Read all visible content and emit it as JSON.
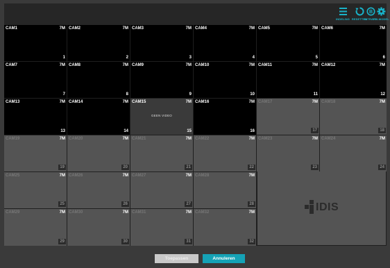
{
  "toolbar": {
    "accent": "#19b3c9",
    "buttons": [
      {
        "name": "layout-button",
        "icon": "layout-list-icon",
        "label": "INDELING"
      },
      {
        "name": "reset-button",
        "icon": "refresh-icon",
        "label": "RESETTEN"
      },
      {
        "name": "bitrate-button",
        "icon": "gauge-icon",
        "label": "BITRATE"
      },
      {
        "name": "full-model-button",
        "icon": "gear-icon",
        "label": "VOLMODEL"
      }
    ]
  },
  "grid": {
    "colors": {
      "active": "#000000",
      "inactive": "#545454"
    },
    "cameras": [
      {
        "name": "CAM1",
        "res": "7M",
        "num": "1",
        "state": "on"
      },
      {
        "name": "CAM2",
        "res": "7M",
        "num": "2",
        "state": "on"
      },
      {
        "name": "CAM3",
        "res": "7M",
        "num": "3",
        "state": "on"
      },
      {
        "name": "CAM4",
        "res": "7M",
        "num": "4",
        "state": "on"
      },
      {
        "name": "CAM5",
        "res": "7M",
        "num": "5",
        "state": "on"
      },
      {
        "name": "CAM6",
        "res": "7M",
        "num": "6",
        "state": "on"
      },
      {
        "name": "CAM7",
        "res": "7M",
        "num": "7",
        "state": "on"
      },
      {
        "name": "CAM8",
        "res": "7M",
        "num": "8",
        "state": "on"
      },
      {
        "name": "CAM9",
        "res": "7M",
        "num": "9",
        "state": "on"
      },
      {
        "name": "CAM10",
        "res": "7M",
        "num": "10",
        "state": "on"
      },
      {
        "name": "CAM11",
        "res": "7M",
        "num": "11",
        "state": "on"
      },
      {
        "name": "CAM12",
        "res": "7M",
        "num": "12",
        "state": "on"
      },
      {
        "name": "CAM13",
        "res": "7M",
        "num": "13",
        "state": "on"
      },
      {
        "name": "CAM14",
        "res": "7M",
        "num": "14",
        "state": "on"
      },
      {
        "name": "CAM15",
        "res": "7M",
        "num": "15",
        "state": "nosig",
        "message": "GEEN VIDEO"
      },
      {
        "name": "CAM16",
        "res": "7M",
        "num": "16",
        "state": "on"
      },
      {
        "name": "CAM17",
        "res": "7M",
        "num": "17",
        "state": "off"
      },
      {
        "name": "CAM18",
        "res": "7M",
        "num": "18",
        "state": "off"
      },
      {
        "name": "CAM19",
        "res": "7M",
        "num": "19",
        "state": "off"
      },
      {
        "name": "CAM20",
        "res": "7M",
        "num": "20",
        "state": "off"
      },
      {
        "name": "CAM21",
        "res": "7M",
        "num": "21",
        "state": "off"
      },
      {
        "name": "CAM22",
        "res": "7M",
        "num": "22",
        "state": "off"
      },
      {
        "name": "CAM23",
        "res": "7M",
        "num": "23",
        "state": "off"
      },
      {
        "name": "CAM24",
        "res": "7M",
        "num": "24",
        "state": "off"
      },
      {
        "name": "CAM25",
        "res": "7M",
        "num": "25",
        "state": "off"
      },
      {
        "name": "CAM26",
        "res": "7M",
        "num": "26",
        "state": "off"
      },
      {
        "name": "CAM27",
        "res": "7M",
        "num": "27",
        "state": "off"
      },
      {
        "name": "CAM28",
        "res": "7M",
        "num": "28",
        "state": "off"
      },
      {
        "name": "CAM29",
        "res": "7M",
        "num": "29",
        "state": "off"
      },
      {
        "name": "CAM30",
        "res": "7M",
        "num": "30",
        "state": "off"
      },
      {
        "name": "CAM31",
        "res": "7M",
        "num": "31",
        "state": "off"
      },
      {
        "name": "CAM32",
        "res": "7M",
        "num": "32",
        "state": "off"
      }
    ]
  },
  "logo": {
    "text": "IDIS"
  },
  "footer": {
    "apply_label": "Toepassen",
    "cancel_label": "Annuleren",
    "cancel_color": "#15a2b6"
  }
}
